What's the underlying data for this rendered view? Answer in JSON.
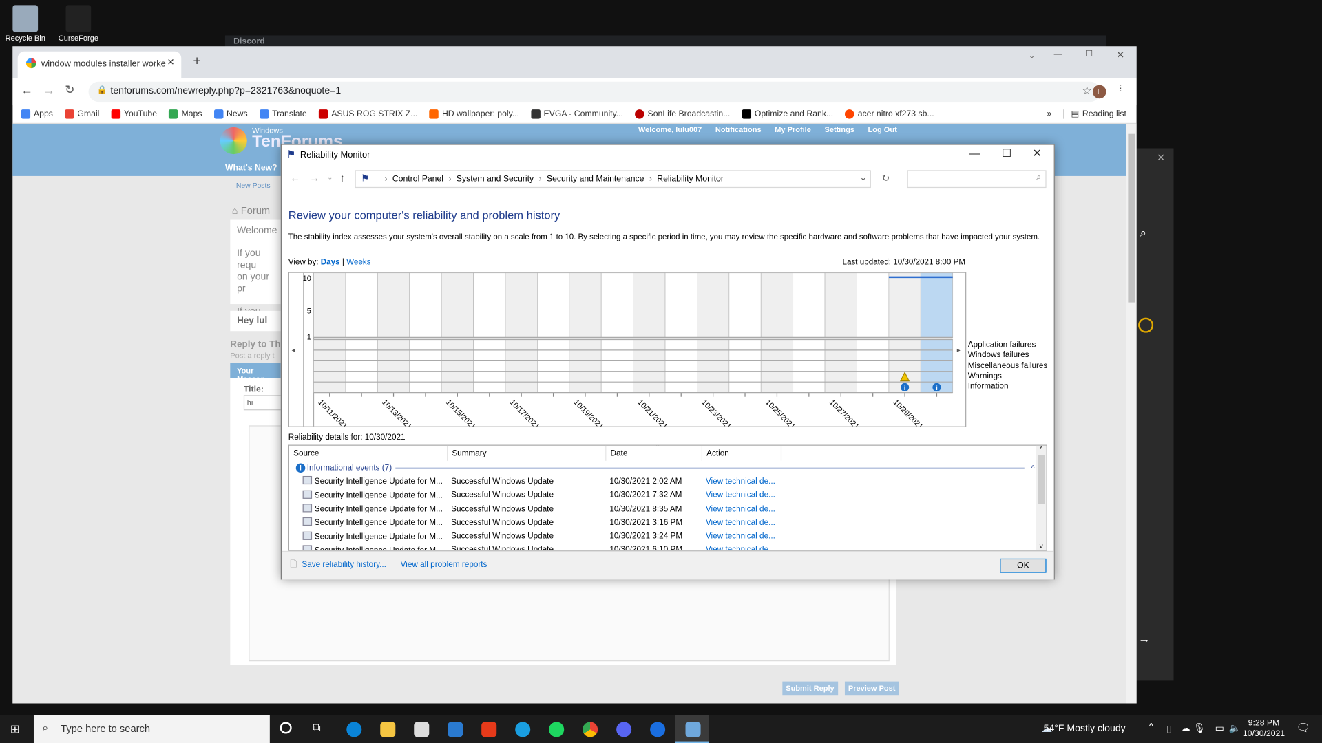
{
  "desktop": {
    "icons": [
      {
        "label": "Recycle Bin"
      },
      {
        "label": "CurseForge"
      }
    ],
    "background_window": "Discord"
  },
  "browser": {
    "tab_title": "window modules installer worke",
    "url": "tenforums.com/newreply.php?p=2321763&noquote=1",
    "bookmarks": [
      {
        "label": "Apps",
        "color": "#4285f4"
      },
      {
        "label": "Gmail",
        "color": "#ea4335"
      },
      {
        "label": "YouTube",
        "color": "#ff0000"
      },
      {
        "label": "Maps",
        "color": "#34a853"
      },
      {
        "label": "News",
        "color": "#4285f4"
      },
      {
        "label": "Translate",
        "color": "#4285f4"
      },
      {
        "label": "ASUS ROG STRIX Z...",
        "color": "#c00"
      },
      {
        "label": "HD wallpaper: poly...",
        "color": "#f60"
      },
      {
        "label": "EVGA - Community...",
        "color": "#333"
      },
      {
        "label": "SonLife Broadcastin...",
        "color": "#b00"
      },
      {
        "label": "Optimize and Rank...",
        "color": "#000"
      },
      {
        "label": "acer nitro xf273 sb...",
        "color": "#ff4500"
      }
    ],
    "more": "»",
    "reading_list": "Reading list",
    "profile_initial": "L"
  },
  "forum": {
    "logo_small": "Windows",
    "logo_big": "TenForums",
    "nav": {
      "welcome": "Welcome,",
      "user": "lulu007",
      "notifications": "Notifications",
      "profile": "My Profile",
      "settings": "Settings",
      "logout": "Log Out"
    },
    "whats_new": "What's New?",
    "new_posts": "New Posts",
    "breadcrumb": "Forum",
    "welcome_text": "Welcome",
    "if_req": "If you requ",
    "on_your": "on your pr",
    "if_have": "If you have",
    "hey": "Hey lul",
    "reply_to": "Reply to Th",
    "post_reply": "Post a reply t",
    "your_message": "Your Messag",
    "title_label": "Title:",
    "title_value": "hi",
    "submit": "Submit Reply",
    "preview": "Preview Post"
  },
  "dialog": {
    "title": "Reliability Monitor",
    "breadcrumb": [
      "Control Panel",
      "System and Security",
      "Security and Maintenance",
      "Reliability Monitor"
    ],
    "heading": "Review your computer's reliability and problem history",
    "description": "The stability index assesses your system's overall stability on a scale from 1 to 10. By selecting a specific period in time, you may review the specific hardware and software problems that have impacted your system.",
    "view_by": "View by:",
    "days": "Days",
    "sep": "|",
    "weeks": "Weeks",
    "last_updated": "Last updated: 10/30/2021 8:00 PM",
    "details_for": "Reliability details for: 10/30/2021",
    "columns": [
      "Source",
      "Summary",
      "Date",
      "Action"
    ],
    "group": "Informational events (7)",
    "rows": [
      {
        "source": "Security Intelligence Update for M...",
        "summary": "Successful Windows Update",
        "date": "10/30/2021 2:02 AM",
        "action": "View technical de..."
      },
      {
        "source": "Security Intelligence Update for M...",
        "summary": "Successful Windows Update",
        "date": "10/30/2021 7:32 AM",
        "action": "View technical de..."
      },
      {
        "source": "Security Intelligence Update for M...",
        "summary": "Successful Windows Update",
        "date": "10/30/2021 8:35 AM",
        "action": "View technical de..."
      },
      {
        "source": "Security Intelligence Update for M...",
        "summary": "Successful Windows Update",
        "date": "10/30/2021 3:16 PM",
        "action": "View technical de..."
      },
      {
        "source": "Security Intelligence Update for M...",
        "summary": "Successful Windows Update",
        "date": "10/30/2021 3:24 PM",
        "action": "View technical de..."
      },
      {
        "source": "Security Intelligence Update for M...",
        "summary": "Successful Windows Update",
        "date": "10/30/2021 6:10 PM",
        "action": "View technical de..."
      }
    ],
    "save_history": "Save reliability history...",
    "view_all": "View all problem reports",
    "ok": "OK"
  },
  "chart_data": {
    "type": "line",
    "x": [
      "10/11/2021",
      "10/12/2021",
      "10/13/2021",
      "10/14/2021",
      "10/15/2021",
      "10/16/2021",
      "10/17/2021",
      "10/18/2021",
      "10/19/2021",
      "10/20/2021",
      "10/21/2021",
      "10/22/2021",
      "10/23/2021",
      "10/24/2021",
      "10/25/2021",
      "10/26/2021",
      "10/27/2021",
      "10/28/2021",
      "10/29/2021",
      "10/30/2021"
    ],
    "tick_labels": [
      "10/11/2021",
      "10/13/2021",
      "10/15/2021",
      "10/17/2021",
      "10/19/2021",
      "10/21/2021",
      "10/23/2021",
      "10/25/2021",
      "10/27/2021",
      "10/29/2021"
    ],
    "yticks": [
      "10",
      "5",
      "1"
    ],
    "ylim": [
      1,
      10
    ],
    "series": [
      {
        "values": [
          null,
          null,
          null,
          null,
          null,
          null,
          null,
          null,
          null,
          null,
          null,
          null,
          null,
          null,
          null,
          null,
          null,
          null,
          10,
          10
        ]
      }
    ],
    "selected": "10/30/2021",
    "event_rows": [
      "Application failures",
      "Windows failures",
      "Miscellaneous failures",
      "Warnings",
      "Information"
    ],
    "events": {
      "Warnings": [
        "10/29/2021"
      ],
      "Information": [
        "10/29/2021",
        "10/30/2021"
      ]
    },
    "colors": {
      "line": "#2f6fd0",
      "selected": "#bcd8f2",
      "shade": "#efefef",
      "info": "#1c6fc8",
      "warning": "#f0c400"
    }
  },
  "taskbar": {
    "search_placeholder": "Type here to search",
    "weather": "54°F  Mostly cloudy",
    "time": "9:28 PM",
    "date": "10/30/2021"
  }
}
